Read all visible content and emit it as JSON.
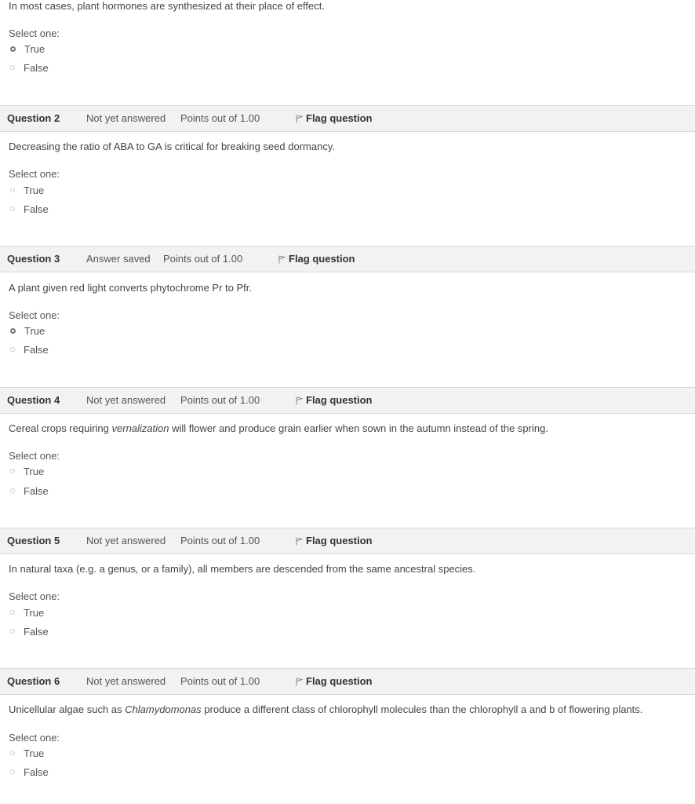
{
  "q1": {
    "text": "In most cases, plant hormones are synthesized at their place of effect.",
    "select_label": "Select one:",
    "options": [
      "True",
      "False"
    ],
    "selected": 0
  },
  "questions": [
    {
      "number": "Question 2",
      "state": "Not yet answered",
      "points": "Points out of 1.00",
      "flag": "Flag question",
      "text": "Decreasing the ratio of ABA to GA is critical for breaking seed dormancy.",
      "select_label": "Select one:",
      "options": [
        "True",
        "False"
      ],
      "selected": null
    },
    {
      "number": "Question 3",
      "state": "Answer saved",
      "points": "Points out of 1.00",
      "flag": "Flag question",
      "text": "A plant given red light converts phytochrome Pr to Pfr.",
      "select_label": "Select one:",
      "options": [
        "True",
        "False"
      ],
      "selected": 0
    },
    {
      "number": "Question 4",
      "state": "Not yet answered",
      "points": "Points out of 1.00",
      "flag": "Flag question",
      "text_before": "Cereal crops requiring ",
      "text_em": "vernalization",
      "text_after": " will flower and produce grain earlier when sown in the autumn instead of the spring.",
      "select_label": "Select one:",
      "options": [
        "True",
        "False"
      ],
      "selected": null
    },
    {
      "number": "Question 5",
      "state": "Not yet answered",
      "points": "Points out of 1.00",
      "flag": "Flag question",
      "text": "In natural taxa (e.g. a genus, or a family), all members are descended from the same ancestral species.",
      "select_label": "Select one:",
      "options": [
        "True",
        "False"
      ],
      "selected": null
    },
    {
      "number": "Question 6",
      "state": "Not yet answered",
      "points": "Points out of 1.00",
      "flag": "Flag question",
      "text_before": "Unicellular algae such as ",
      "text_em": "Chlamydomonas",
      "text_after": " produce a different class of chlorophyll molecules than the chlorophyll a and b of flowering plants.",
      "select_label": "Select one:",
      "options": [
        "True",
        "False"
      ],
      "selected": null
    }
  ]
}
